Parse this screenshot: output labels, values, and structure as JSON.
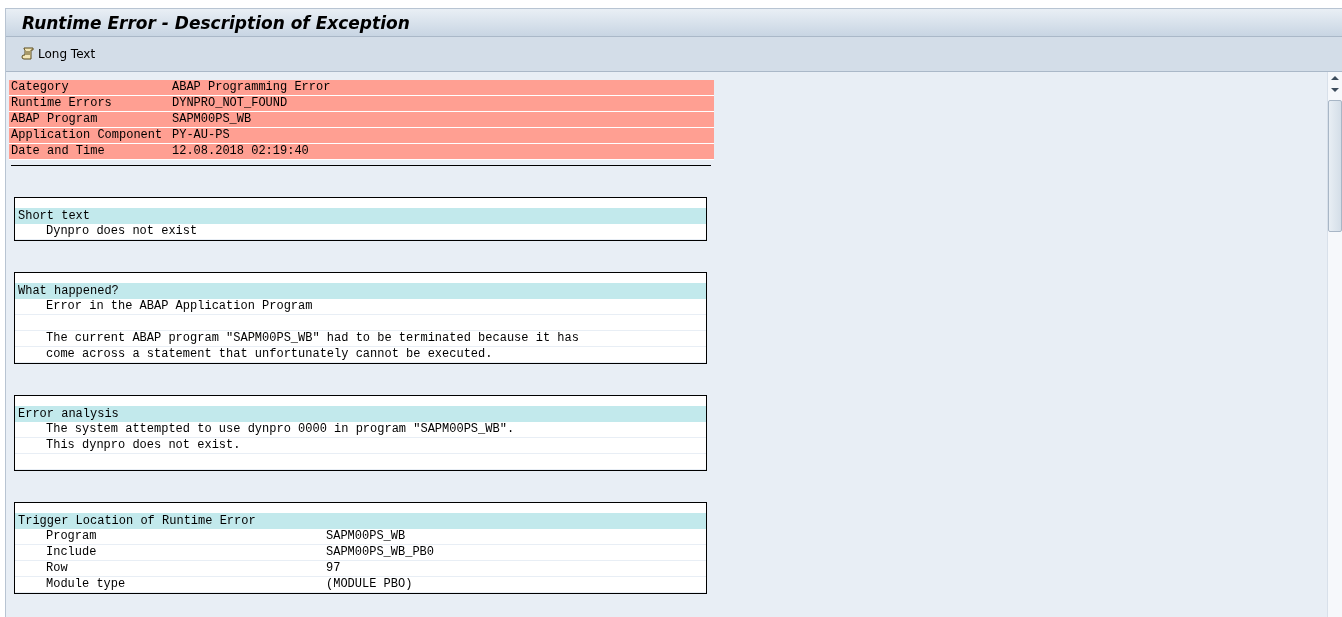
{
  "window": {
    "title": "Runtime Error - Description of Exception"
  },
  "toolbar": {
    "buttons": [
      {
        "label": "Long Text"
      }
    ]
  },
  "header_rows": [
    {
      "label": "Category",
      "value": "ABAP Programming Error"
    },
    {
      "label": "Runtime Errors",
      "value": "DYNPRO_NOT_FOUND"
    },
    {
      "label": "ABAP Program",
      "value": "SAPM00PS_WB"
    },
    {
      "label": "Application Component",
      "value": "PY-AU-PS"
    },
    {
      "label": "Date and Time",
      "value": "12.08.2018 02:19:40"
    }
  ],
  "sections": [
    {
      "title": "Short text",
      "lines": [
        {
          "kind": "text",
          "text": "Dynpro does not exist"
        }
      ]
    },
    {
      "title": "What happened?",
      "lines": [
        {
          "kind": "text",
          "text": "Error in the ABAP Application Program"
        },
        {
          "kind": "blank"
        },
        {
          "kind": "text",
          "text": "The current ABAP program \"SAPM00PS_WB\" had to be terminated because it has"
        },
        {
          "kind": "text",
          "text": "come across a statement that unfortunately cannot be executed."
        }
      ]
    },
    {
      "title": "Error analysis",
      "lines": [
        {
          "kind": "text",
          "text": "The system attempted to use dynpro 0000 in program \"SAPM00PS_WB\"."
        },
        {
          "kind": "text",
          "text": "This dynpro does not exist."
        },
        {
          "kind": "blank"
        }
      ]
    },
    {
      "title": "Trigger Location of Runtime Error",
      "lines": [
        {
          "kind": "pair",
          "label": "Program",
          "value": "SAPM00PS_WB"
        },
        {
          "kind": "pair",
          "label": "Include",
          "value": "SAPM00PS_WB_PB0"
        },
        {
          "kind": "pair",
          "label": "Row",
          "value": "97"
        },
        {
          "kind": "pair",
          "label": "Module type",
          "value": "(MODULE PBO)"
        }
      ]
    }
  ]
}
